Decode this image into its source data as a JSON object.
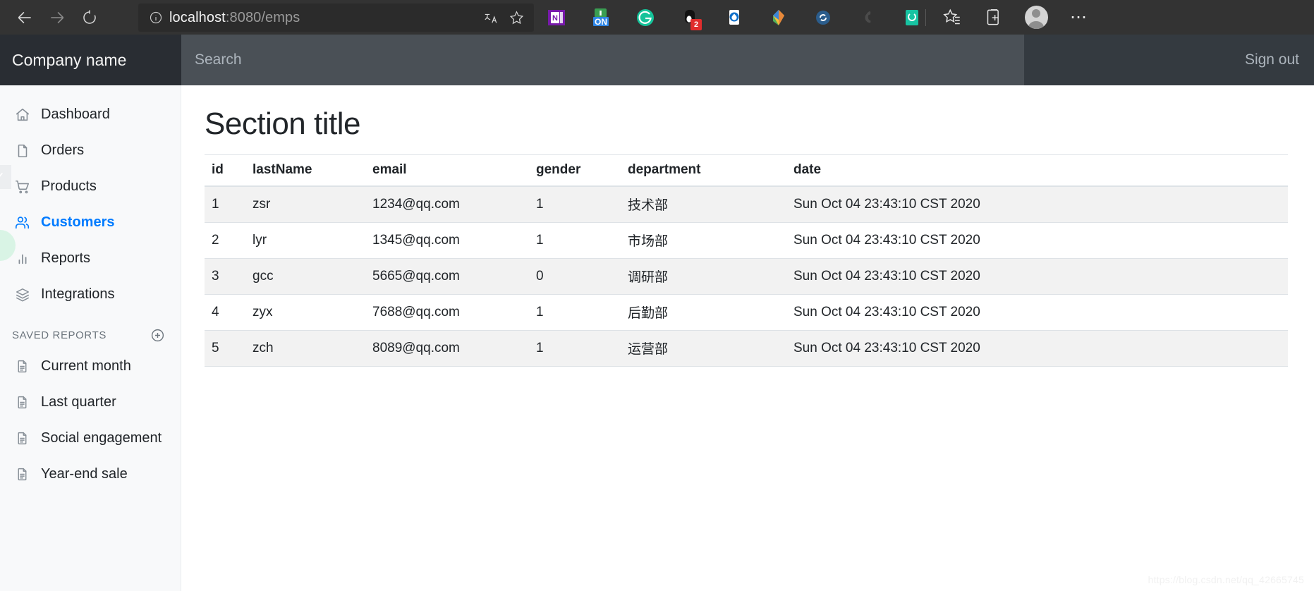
{
  "browser": {
    "back_label": "Back",
    "forward_label": "Forward",
    "reload_label": "Reload",
    "url_host": "localhost",
    "url_rest": ":8080/emps",
    "url_full": "localhost:8080/emps",
    "site_info_label": "Site information",
    "translate_label": "Translate this page",
    "favorite_label": "Add to favorites",
    "extensions": [
      {
        "name": "onenote-extension-icon",
        "label": "OneNote"
      },
      {
        "name": "on-extension-icon",
        "label": "ON"
      },
      {
        "name": "grammarly-extension-icon",
        "label": "Grammarly"
      },
      {
        "name": "notification-extension-icon",
        "label": "Notifications",
        "badge": "2"
      },
      {
        "name": "water-drop-extension-icon",
        "label": "Drop"
      },
      {
        "name": "colorful-diamond-extension-icon",
        "label": "Diamond"
      },
      {
        "name": "sync-extension-icon",
        "label": "Sync"
      },
      {
        "name": "spiral-extension-icon",
        "label": "Spiral"
      },
      {
        "name": "refresh-extension-icon",
        "label": "Refresh"
      }
    ],
    "collections_label": "Collections",
    "favorites_bar_label": "Favorites",
    "profile_label": "Profile",
    "settings_label": "Settings and more"
  },
  "navbar": {
    "brand": "Company name",
    "search_placeholder": "Search",
    "search_value": "",
    "signout_label": "Sign out"
  },
  "sidebar": {
    "items": [
      {
        "label": "Dashboard",
        "icon": "home-icon",
        "active": false
      },
      {
        "label": "Orders",
        "icon": "file-icon",
        "active": false
      },
      {
        "label": "Products",
        "icon": "shopping-cart-icon",
        "active": false
      },
      {
        "label": "Customers",
        "icon": "users-icon",
        "active": true
      },
      {
        "label": "Reports",
        "icon": "bar-chart-icon",
        "active": false
      },
      {
        "label": "Integrations",
        "icon": "layers-icon",
        "active": false
      }
    ],
    "saved_reports_heading": "Saved reports",
    "add_report_label": "Add report",
    "saved_reports": [
      {
        "label": "Current month",
        "icon": "file-text-icon"
      },
      {
        "label": "Last quarter",
        "icon": "file-text-icon"
      },
      {
        "label": "Social engagement",
        "icon": "file-text-icon"
      },
      {
        "label": "Year-end sale",
        "icon": "file-text-icon"
      }
    ]
  },
  "main": {
    "section_title": "Section title",
    "table": {
      "columns": [
        "id",
        "lastName",
        "email",
        "gender",
        "department",
        "date"
      ],
      "rows": [
        {
          "id": "1",
          "lastName": "zsr",
          "email": "1234@qq.com",
          "gender": "1",
          "department": "技术部",
          "date": "Sun Oct 04 23:43:10 CST 2020"
        },
        {
          "id": "2",
          "lastName": "lyr",
          "email": "1345@qq.com",
          "gender": "1",
          "department": "市场部",
          "date": "Sun Oct 04 23:43:10 CST 2020"
        },
        {
          "id": "3",
          "lastName": "gcc",
          "email": "5665@qq.com",
          "gender": "0",
          "department": "调研部",
          "date": "Sun Oct 04 23:43:10 CST 2020"
        },
        {
          "id": "4",
          "lastName": "zyx",
          "email": "7688@qq.com",
          "gender": "1",
          "department": "后勤部",
          "date": "Sun Oct 04 23:43:10 CST 2020"
        },
        {
          "id": "5",
          "lastName": "zch",
          "email": "8089@qq.com",
          "gender": "1",
          "department": "运营部",
          "date": "Sun Oct 04 23:43:10 CST 2020"
        }
      ]
    }
  },
  "watermark": "https://blog.csdn.net/qq_42665745",
  "colors": {
    "brand_bg": "#292d33",
    "navbar_bg": "#4a5056",
    "navbar_right_bg": "#343a40",
    "sidebar_bg": "#f8f9fa",
    "accent": "#007bff",
    "browser_chrome": "#333333",
    "row_stripe": "#f2f2f2"
  }
}
